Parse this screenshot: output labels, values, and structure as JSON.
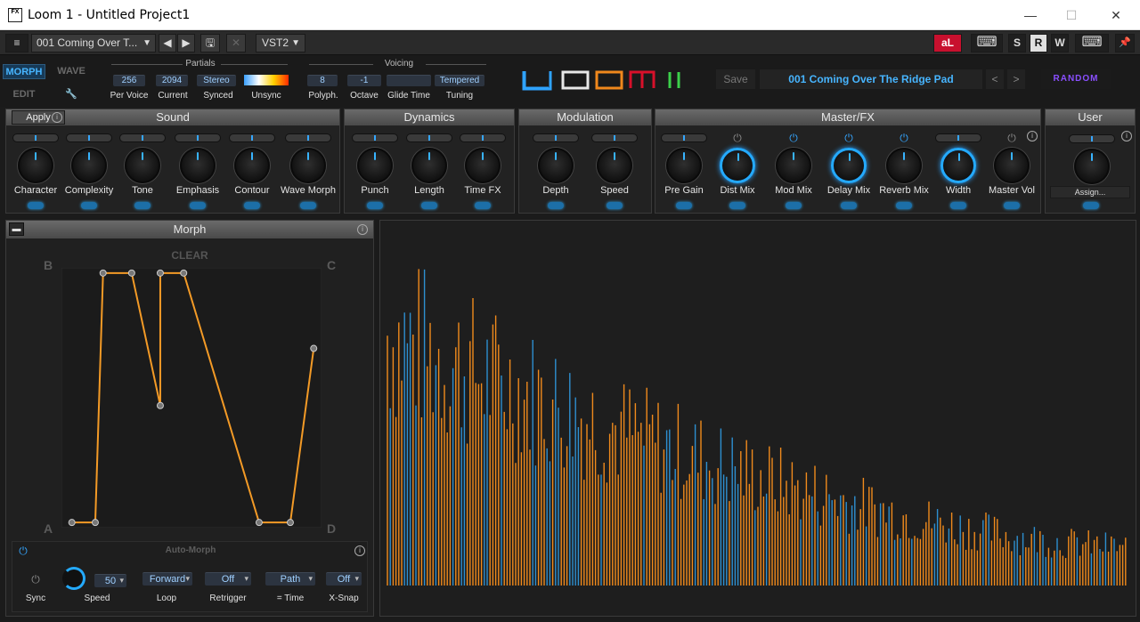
{
  "window": {
    "title": "Loom 1 - Untitled Project1",
    "icon_text": "FX",
    "min": "—",
    "max": "☐",
    "close": "✕"
  },
  "host": {
    "menu_icon": "≡",
    "preset": "001 Coming Over T...",
    "preset_arrow": "▼",
    "prev": "◀",
    "next": "▶",
    "save_icon": "🖫",
    "close_icon": "✕",
    "format": "VST2",
    "format_arrow": "▼",
    "al_badge": "aL",
    "keyboard_icon": "⌨",
    "s": "S",
    "r": "R",
    "w": "W",
    "pin_icon": "📌"
  },
  "plugin": {
    "tabs": {
      "morph": "MORPH",
      "wave": "WAVE",
      "edit": "EDIT",
      "tools": "🔧"
    },
    "partials": {
      "label": "Partials",
      "per_voice": "256",
      "per_voice_label": "Per Voice",
      "current": "2094",
      "current_label": "Current",
      "synced": "Stereo",
      "synced_label": "Synced",
      "unsync_label": "Unsync"
    },
    "voicing": {
      "label": "Voicing",
      "polyph": "8",
      "polyph_label": "Polyph.",
      "octave": "-1",
      "octave_label": "Octave",
      "glide_label": "Glide Time",
      "tuning": "Tempered",
      "tuning_label": "Tuning"
    },
    "logo": "LOOM II",
    "save": "Save",
    "preset_name": "001 Coming Over The Ridge Pad",
    "prev": "<",
    "next": ">",
    "random": "RANDOM"
  },
  "sections": {
    "sound": {
      "title": "Sound",
      "apply": "Apply",
      "knobs": [
        "Character",
        "Complexity",
        "Tone",
        "Emphasis",
        "Contour",
        "Wave Morph"
      ]
    },
    "dynamics": {
      "title": "Dynamics",
      "knobs": [
        "Punch",
        "Length",
        "Time FX"
      ]
    },
    "modulation": {
      "title": "Modulation",
      "knobs": [
        "Depth",
        "Speed"
      ]
    },
    "master": {
      "title": "Master/FX",
      "knobs": [
        "Pre Gain",
        "Dist Mix",
        "Mod Mix",
        "Delay Mix",
        "Reverb Mix",
        "Width",
        "Master Vol"
      ]
    },
    "user": {
      "title": "User",
      "assign": "Assign..."
    }
  },
  "morph": {
    "title": "Morph",
    "clear": "CLEAR",
    "corners": {
      "a": "A",
      "b": "B",
      "c": "C",
      "d": "D"
    },
    "path_points": [
      [
        0.04,
        0.02
      ],
      [
        0.13,
        0.02
      ],
      [
        0.16,
        0.98
      ],
      [
        0.27,
        0.98
      ],
      [
        0.38,
        0.47
      ],
      [
        0.38,
        0.98
      ],
      [
        0.47,
        0.98
      ],
      [
        0.76,
        0.02
      ],
      [
        0.88,
        0.02
      ],
      [
        0.97,
        0.69
      ]
    ],
    "auto_morph": {
      "title": "Auto-Morph",
      "sync_label": "Sync",
      "speed_value": "50",
      "speed_label": "Speed",
      "loop_value": "Forward",
      "loop_label": "Loop",
      "retrigger_value": "Off",
      "retrigger_label": "Retrigger",
      "time_value": "Path",
      "time_label": "= Time",
      "xsnap_value": "Off",
      "xsnap_label": "X-Snap"
    }
  },
  "colors": {
    "accent": "#35a6ff",
    "orange": "#f08a1c",
    "path": "#f39a26"
  }
}
